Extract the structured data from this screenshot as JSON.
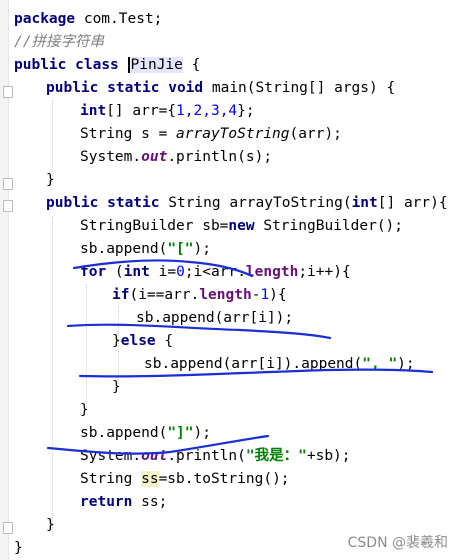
{
  "editor": {
    "code": {
      "l1_kw": "package",
      "l1_rest": " com.Test;",
      "l2_comment": "//拼接字符串",
      "l3_kw1": "public",
      "l3_kw2": "class",
      "l3_name": "PinJie",
      "l3_rest": " {",
      "l4_kw": "public static void",
      "l4_rest": " main(String[] args) {",
      "l5_kw": "int",
      "l5_a": "[] arr={",
      "l5_nums": "1,2,3,4",
      "l5_b": "};",
      "l6_a": "String s = ",
      "l6_m": "arrayToString",
      "l6_b": "(arr);",
      "l7_a": "System.",
      "l7_out": "out",
      "l7_b": ".println(s);",
      "l8": "}",
      "l9_kw": "public static",
      "l9_a": " String arrayToString(",
      "l9_kw2": "int",
      "l9_b": "[] arr){",
      "l10_a": "StringBuilder sb=",
      "l10_kw": "new",
      "l10_b": " StringBuilder();",
      "l11_a": "sb.append(",
      "l11_s": "\"[\"",
      "l11_b": ");",
      "l12_kw": "for",
      "l12_a": " (",
      "l12_kw2": "int",
      "l12_b": " i=",
      "l12_n": "0",
      "l12_c": ";i<arr.",
      "l12_f": "length",
      "l12_d": ";i++){",
      "l13_kw": "if",
      "l13_a": "(i==arr.",
      "l13_f": "length",
      "l13_b": "-",
      "l13_n": "1",
      "l13_c": "){",
      "l14": "sb.append(arr[i]);",
      "l15_a": "}",
      "l15_kw": "else",
      "l15_b": " {",
      "l16_a": "sb.append(arr[i]).append(",
      "l16_s": "\", \"",
      "l16_b": ");",
      "l17": "}",
      "l18": "}",
      "l19_a": "sb.append(",
      "l19_s": "\"]\"",
      "l19_b": ");",
      "l20_a": "System.",
      "l20_out": "out",
      "l20_b": ".println(",
      "l20_s": "\"我是：\"",
      "l20_c": "+sb);",
      "l21_a": "String ",
      "l21_var": "ss",
      "l21_b": "=sb.toString();",
      "l22_kw": "return",
      "l22_a": " ss;",
      "l23": "}",
      "l24": "}"
    },
    "watermark": "CSDN @裴羲和"
  },
  "colors": {
    "keyword": "#000080",
    "string": "#008000",
    "number": "#0000ff",
    "comment": "#808080",
    "field": "#660e7a",
    "ink": "#1a2fd6"
  }
}
